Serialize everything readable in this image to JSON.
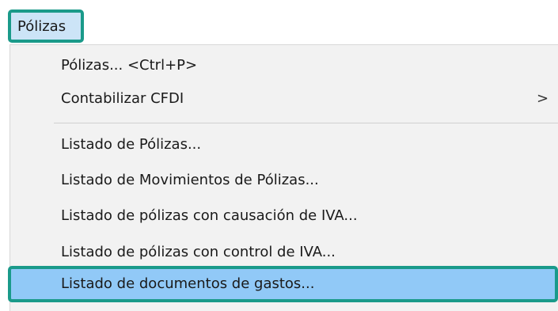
{
  "menubar": {
    "title": "Pólizas"
  },
  "menu": {
    "items": [
      {
        "label": "Pólizas... <Ctrl+P>"
      },
      {
        "label": "Contabilizar CFDI",
        "submenu_arrow": ">"
      },
      {
        "label": "Listado de Pólizas..."
      },
      {
        "label": "Listado de Movimientos de Pólizas..."
      },
      {
        "label": "Listado de pólizas con causación de IVA..."
      },
      {
        "label": "Listado de pólizas con control de IVA..."
      },
      {
        "label": "Listado de documentos de gastos...",
        "highlighted": true
      }
    ]
  },
  "colors": {
    "highlight_frame": "#1a9a8a",
    "hover_background": "#91c9f7",
    "menubar_selected_background": "#cce4f7",
    "menu_background": "#f2f2f2"
  }
}
